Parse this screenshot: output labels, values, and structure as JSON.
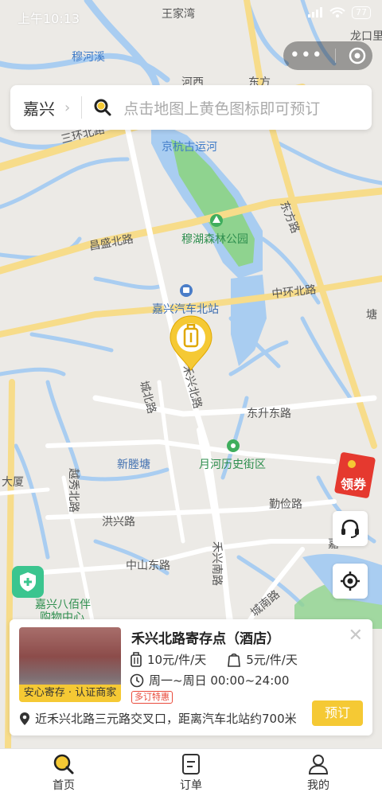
{
  "status_bar": {
    "time": "上午10:13",
    "battery": "77"
  },
  "search": {
    "city": "嘉兴",
    "placeholder": "点击地图上黄色图标即可预订"
  },
  "map": {
    "labels": {
      "l1": "王家湾",
      "l2": "穆河溪",
      "l3": "龙口里",
      "l4": "河西",
      "l5": "东方",
      "l6": "三环北路",
      "l7": "京杭古运河",
      "l8": "东方路",
      "l9": "昌盛北路",
      "l10": "穆湖森林公园",
      "l11": "中环北路",
      "l12": "嘉兴汽车北站",
      "l13": "塘",
      "l14": "禾兴北路",
      "l15": "城北路",
      "l16": "东升东路",
      "l17": "新塍塘",
      "l18": "月河历史街区",
      "l19": "大厦",
      "l20": "越秀北路",
      "l21": "勤俭路",
      "l22": "洪兴路",
      "l23": "中山东路",
      "l24": "禾兴南路",
      "l25": "嘉兴八佰伴",
      "l26": "购物中心",
      "l27": "城南路",
      "l28": "嘉"
    }
  },
  "coupon": {
    "label": "领券"
  },
  "card": {
    "badge": "安心寄存 · 认证商家",
    "name": "禾兴北路寄存点（酒店）",
    "price_luggage": "10元/件/天",
    "price_bag": "5元/件/天",
    "hours": "周一~周日 00:00~24:00",
    "tag": "多订特惠",
    "address": "近禾兴北路三元路交叉口，距离汽车北站约700米",
    "book_label": "预订"
  },
  "tabs": [
    {
      "label": "首页"
    },
    {
      "label": "订单"
    },
    {
      "label": "我的"
    }
  ],
  "colors": {
    "accent": "#f5c934",
    "water": "#a9cdf1",
    "park": "#8fd38f",
    "road_major": "#f7dc8a",
    "green_button": "#3bc58f"
  }
}
